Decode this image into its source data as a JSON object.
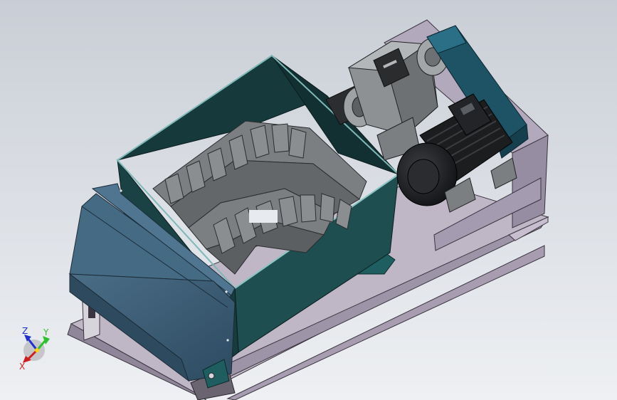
{
  "viewport": {
    "background_top": "#c9ced6",
    "background_bottom": "#eef0f3"
  },
  "model": {
    "components": [
      "base-frame",
      "shredder-hopper",
      "shredder-blades",
      "side-cover",
      "gearbox",
      "electric-motor",
      "belt-guard"
    ],
    "colors": {
      "frame": "#a79cb0",
      "hopper": "#1d4a4c",
      "cover": "#375a72",
      "blades": "#6f7375",
      "motor": "#1c1d1f",
      "gearbox": "#8e9194",
      "belt_guard": "#1e5366"
    }
  },
  "triad": {
    "x_label": "X",
    "y_label": "Y",
    "z_label": "Z",
    "x_color": "#d01e1e",
    "y_color": "#2ec12e",
    "z_color": "#1f2fd0"
  }
}
